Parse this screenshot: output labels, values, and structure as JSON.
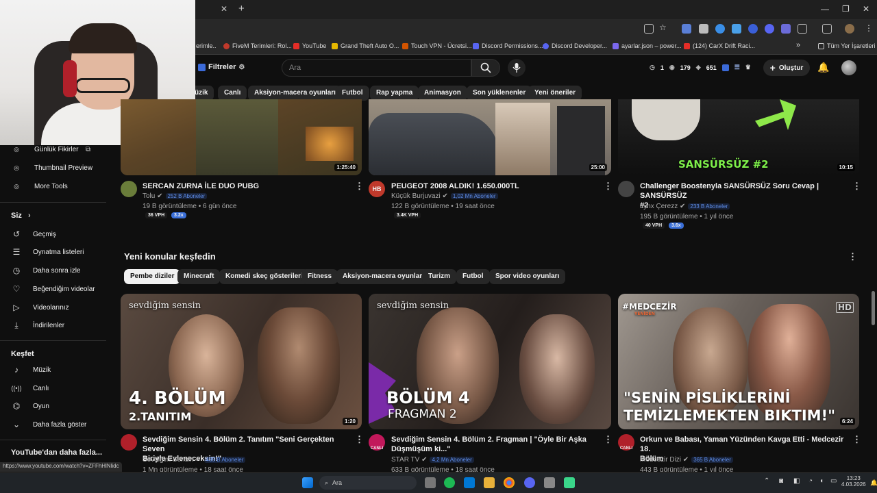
{
  "browser": {
    "bookmarks": [
      {
        "label": "erimle..",
        "color": "#888"
      },
      {
        "label": "FiveM Terimleri: Rol...",
        "color": "#c0392b"
      },
      {
        "label": "YouTube",
        "color": "#e52d27"
      },
      {
        "label": "Grand Theft Auto O...",
        "color": "#e6b800"
      },
      {
        "label": "Touch VPN - Ücretsi...",
        "color": "#d35400"
      },
      {
        "label": "Discord Permissions...",
        "color": "#5865f2"
      },
      {
        "label": "Discord Developer...",
        "color": "#5865f2"
      },
      {
        "label": "ayarlar.json – power...",
        "color": "#7b68ee"
      },
      {
        "label": "(124) CarX Drift Raci...",
        "color": "#e52d27"
      }
    ],
    "bookmarks_more": "»",
    "all_bookmarks": "Tüm Yer İşaretleri",
    "status_url": "https://www.youtube.com/watch?v=ZFFhHlNlidc"
  },
  "header": {
    "filter_label": "Filtreler",
    "search_placeholder": "Ara",
    "stats": {
      "a": "1",
      "b": "179",
      "c": "651"
    },
    "create_label": "Oluştur"
  },
  "top_chips": [
    "üzik",
    "Canlı",
    "Aksiyon-macera oyunları",
    "Futbol",
    "Rap yapma",
    "Animasyon",
    "Son yüklenenler",
    "Yeni öneriler"
  ],
  "sidebar": {
    "top_items": [
      {
        "label": "Günlük Fikirler",
        "icon": "☺",
        "ext": "⧉"
      },
      {
        "label": "Thumbnail Preview",
        "icon": "☺"
      },
      {
        "label": "More Tools",
        "icon": "☺"
      }
    ],
    "you_heading": "Siz",
    "you_chevron": "›",
    "you_items": [
      {
        "label": "Geçmiş",
        "icon": "↺"
      },
      {
        "label": "Oynatma listeleri",
        "icon": "☰"
      },
      {
        "label": "Daha sonra izle",
        "icon": "◷"
      },
      {
        "label": "Beğendiğim videolar",
        "icon": "👍"
      },
      {
        "label": "Videolarınız",
        "icon": "▶"
      },
      {
        "label": "İndirilenler",
        "icon": "⤓"
      }
    ],
    "explore_heading": "Keşfet",
    "explore_items": [
      {
        "label": "Müzik",
        "icon": "♪"
      },
      {
        "label": "Canlı",
        "icon": "((•))"
      },
      {
        "label": "Oyun",
        "icon": "🎮"
      },
      {
        "label": "Daha fazla göster",
        "icon": "⌄"
      }
    ],
    "more_heading": "YouTube'dan daha fazla..."
  },
  "row1": [
    {
      "title": "SERCAN ZURNA İLE DUO PUBG",
      "title2": "",
      "channel": "Tolu",
      "subs": "252 B Aboneler",
      "meta": "19 B görüntüleme • 6 gün önce",
      "duration": "1:25:40",
      "vph": "36 VPH",
      "mult": "3.2x",
      "avatar_color": "#6a7d3a"
    },
    {
      "title": "PEUGEOT 2008 ALDIK! 1.650.000TL",
      "title2": "",
      "channel": "Küçük Burjuvazi",
      "subs": "1,02 Mn Aboneler",
      "meta": "122 B görüntüleme • 19 saat önce",
      "duration": "25:00",
      "vph": "3.4K VPH",
      "mult": "",
      "avatar_color": "#c0392b",
      "avatar_text": "HB"
    },
    {
      "title": "Challenger Boostenyla SANSÜRSÜZ Soru Cevap | SANSÜRSÜZ",
      "title2": "#2",
      "channel": "Lynx Çerezz",
      "subs": "233 B Aboneler",
      "meta": "195 B görüntüleme • 1 yıl önce",
      "duration": "10:15",
      "vph": "40 VPH",
      "mult": "3.6x",
      "avatar_color": "#444",
      "thumb_text": "SANSÜRSÜZ #2"
    }
  ],
  "section": {
    "title": "Yeni konular keşfedin",
    "more_icon": "⋮",
    "chips": [
      "Pembe diziler",
      "Minecraft",
      "Komedi skeç gösterileri",
      "Fitness",
      "Aksiyon-macera oyunları",
      "Turizm",
      "Futbol",
      "Spor video oyunları"
    ]
  },
  "row2": [
    {
      "title": "Sevdiğim Sensin 4. Bölüm 2. Tanıtım \"Seni Gerçekten Seven",
      "title2": "Biriyle Evleneceksin!\"",
      "channel": "Sevdiğim Sensin",
      "subs": "435 B Aboneler",
      "meta": "1 Mn görüntüleme • 18 saat önce",
      "duration": "1:20",
      "logo": "sevdiğim sensin",
      "big1": "4. BÖLÜM",
      "big2": "2.TANITIM",
      "avatar_color": "#b0202a"
    },
    {
      "title": "Sevdiğim Sensin 4. Bölüm 2. Fragman | \"Öyle Bir Aşka",
      "title2": "Düşmüşüm ki...\"",
      "channel": "STAR TV",
      "subs": "4,2 Mn Aboneler",
      "meta": "633 B görüntüleme • 18 saat önce",
      "duration": "",
      "logo": "sevdiğim sensin",
      "big1": "BÖLÜM 4",
      "big2": "FRAGMAN 2",
      "avatar_color": "#c2185b",
      "avatar_text": "CANLI"
    },
    {
      "title": "Orkun ve Babası, Yaman Yüzünden Kavga Etti - Medcezir 18.",
      "title2": "Bölüm",
      "channel": "Medcezir Dizi",
      "subs": "365 B Aboneler",
      "meta": "443 B görüntüleme • 1 yıl önce",
      "duration": "6:24",
      "logo": "#MEDCEZİR",
      "logo2": "YENİDEN",
      "big1": "\"SENİN PİSLİKLERİNİ",
      "big2": "TEMİZLEMEKTEN BIKTIM!\"",
      "hd": "HD",
      "avatar_color": "#b0202a",
      "avatar_text": "CANLI"
    }
  ],
  "taskbar": {
    "search_label": "Ara",
    "time": "13:23",
    "date": "4.03.2026"
  }
}
